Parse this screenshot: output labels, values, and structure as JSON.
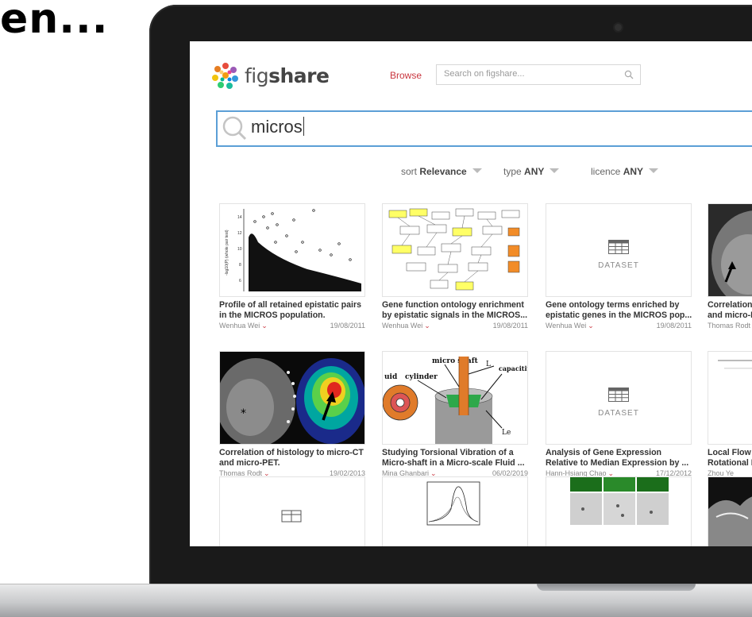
{
  "slide": {
    "title": "en..."
  },
  "header": {
    "logo_text_light": "fig",
    "logo_text_bold": "share",
    "browse_label": "Browse",
    "search_placeholder": "Search on figshare..."
  },
  "main_search": {
    "value": "micros"
  },
  "filters": {
    "sort_label": "sort",
    "sort_value": "Relevance",
    "type_label": "type",
    "type_value": "ANY",
    "licence_label": "licence",
    "licence_value": "ANY"
  },
  "dataset_label": "DATASET",
  "results": [
    {
      "title_line1": "Profile of all retained epistatic pairs",
      "title_line2": "in the MICROS population.",
      "author": "Wenhua Wei",
      "date": "19/08/2011",
      "thumb": "scatter-plot"
    },
    {
      "title_line1": "Gene function ontology enrichment",
      "title_line2": "by epistatic signals in the MICROS...",
      "author": "Wenhua Wei",
      "date": "19/08/2011",
      "thumb": "flowchart"
    },
    {
      "title_line1": "Gene ontology terms enriched by",
      "title_line2": "epistatic genes in the MICROS pop...",
      "author": "Wenhua Wei",
      "date": "19/08/2011",
      "thumb": "dataset"
    },
    {
      "title_line1": "Correlation",
      "title_line2": "and micro-P",
      "author": "Thomas Rodt",
      "date": "",
      "thumb": "ct-scan"
    },
    {
      "title_line1": "Correlation of histology to micro-CT",
      "title_line2": "and micro-PET.",
      "author": "Thomas Rodt",
      "date": "19/02/2013",
      "thumb": "ct-pet"
    },
    {
      "title_line1": "Studying Torsional Vibration of a",
      "title_line2": "Micro-shaft in a Micro-scale Fluid ...",
      "author": "Mina Ghanbari",
      "date": "06/02/2019",
      "thumb": "micro-shaft"
    },
    {
      "title_line1": "Analysis of Gene Expression",
      "title_line2": "Relative to Median Expression by ...",
      "author": "Hann-Hsiang Chao",
      "date": "17/12/2012",
      "thumb": "dataset"
    },
    {
      "title_line1": "Local Flow",
      "title_line2": "Rotational I",
      "author": "Zhou Ye",
      "date": "",
      "thumb": "figure"
    }
  ],
  "diagram_text": {
    "micro_shaft": "micro shaft",
    "cylinder": "cylinder",
    "fluid_partial": "uid",
    "capacitive_partial": "capacitiv",
    "l_label": "L",
    "le_label": "Le",
    "plot_ylabel": "-log10(P) (whole pair test)",
    "ticks": [
      "14",
      "12",
      "10",
      "8",
      "6"
    ]
  }
}
